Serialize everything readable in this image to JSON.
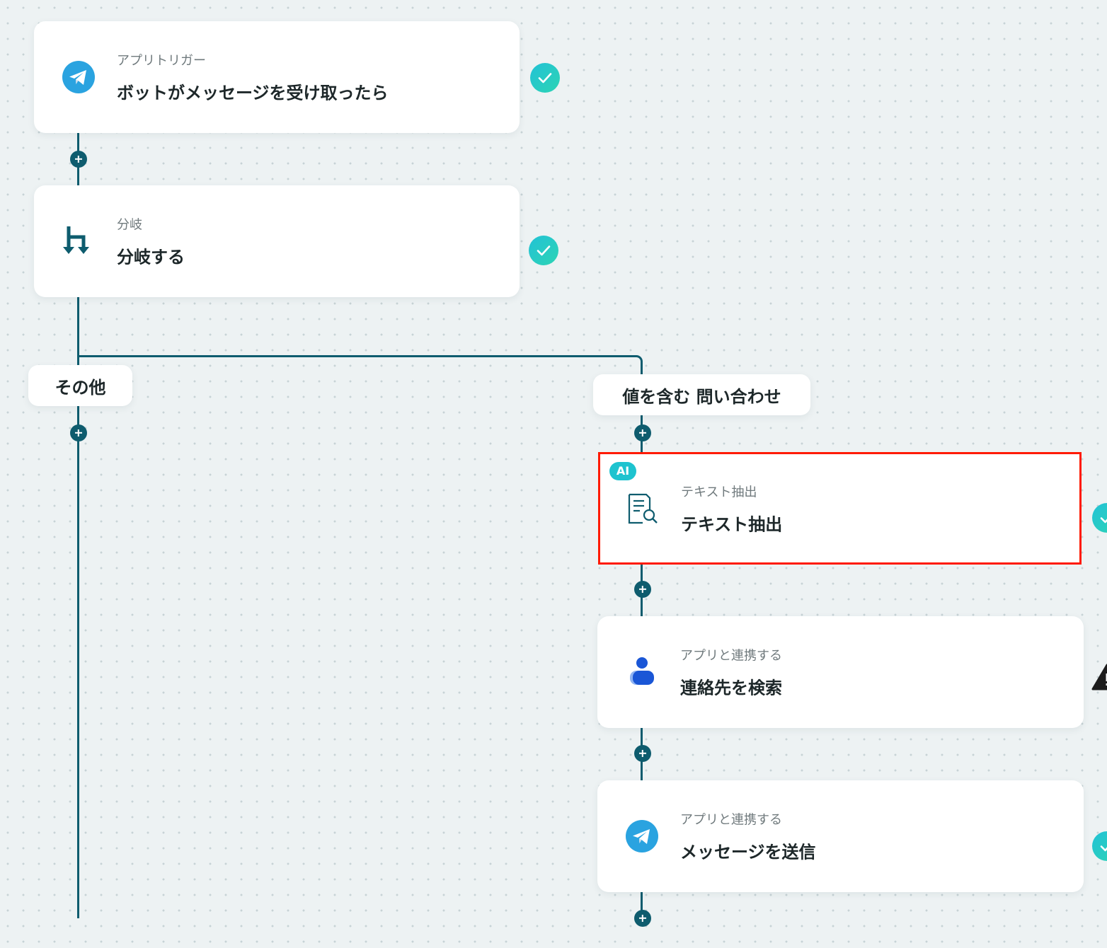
{
  "nodes": [
    {
      "id": "trigger",
      "category": "アプリトリガー",
      "title": "ボットがメッセージを受け取ったら",
      "icon": "telegram-icon",
      "status": "complete"
    },
    {
      "id": "branch",
      "category": "分岐",
      "title": "分岐する",
      "icon": "branch-icon",
      "status": "complete"
    },
    {
      "id": "extract",
      "badge": "AI",
      "category": "テキスト抽出",
      "title": "テキスト抽出",
      "icon": "text-extract-icon",
      "status": "complete",
      "selected": true
    },
    {
      "id": "search",
      "category": "アプリと連携する",
      "title": "連絡先を検索",
      "icon": "contact-person-icon",
      "status": "warning"
    },
    {
      "id": "send",
      "category": "アプリと連携する",
      "title": "メッセージを送信",
      "icon": "telegram-icon",
      "status": "complete"
    }
  ],
  "branches": {
    "other": "その他",
    "contains": "値を含む 問い合わせ"
  },
  "colors": {
    "connector": "#0e5c6e",
    "status_complete": "#22c2d6",
    "selection": "#ff1a00",
    "ai_badge": "#1ec3cf",
    "telegram": "#2aa3e0",
    "contact": "#1a56d6"
  }
}
